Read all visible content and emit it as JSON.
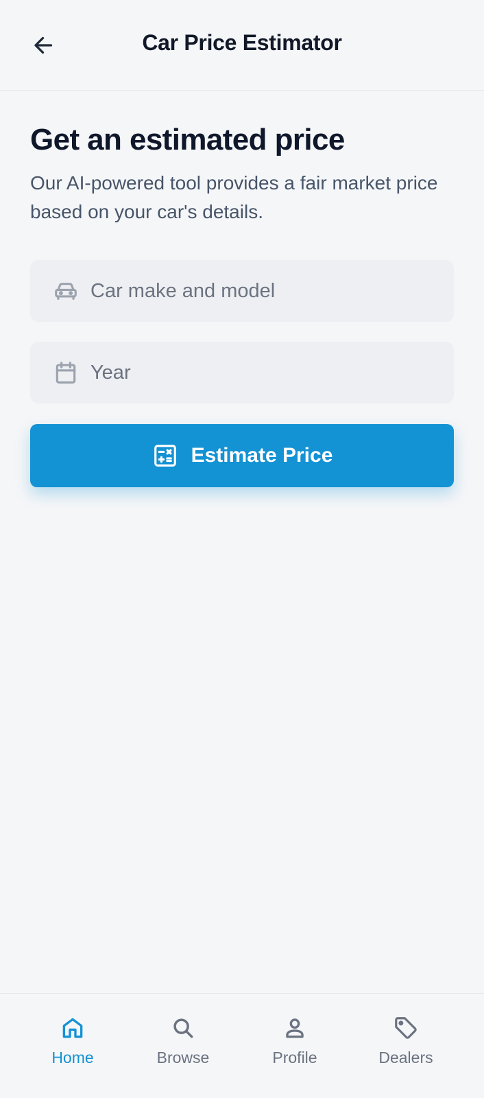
{
  "header": {
    "title": "Car Price Estimator",
    "back_icon": "arrow-left-icon"
  },
  "main": {
    "headline": "Get an estimated price",
    "subtext": "Our AI-powered tool provides a fair market price based on your car's details."
  },
  "form": {
    "make_model": {
      "placeholder": "Car make and model",
      "value": "",
      "icon": "car-icon"
    },
    "year": {
      "placeholder": "Year",
      "value": "",
      "icon": "calendar-icon"
    },
    "submit": {
      "label": "Estimate Price",
      "icon": "calculator-icon"
    }
  },
  "bottom_nav": {
    "items": [
      {
        "label": "Home",
        "icon": "home-icon",
        "active": true
      },
      {
        "label": "Browse",
        "icon": "search-icon",
        "active": false
      },
      {
        "label": "Profile",
        "icon": "user-icon",
        "active": false
      },
      {
        "label": "Dealers",
        "icon": "tag-icon",
        "active": false
      }
    ]
  },
  "colors": {
    "accent": "#1392d4",
    "background": "#f5f6f8",
    "field_background": "#eeeff2",
    "text_primary": "#0f172a",
    "text_secondary": "#475569",
    "icon_muted": "#9ca3af"
  }
}
